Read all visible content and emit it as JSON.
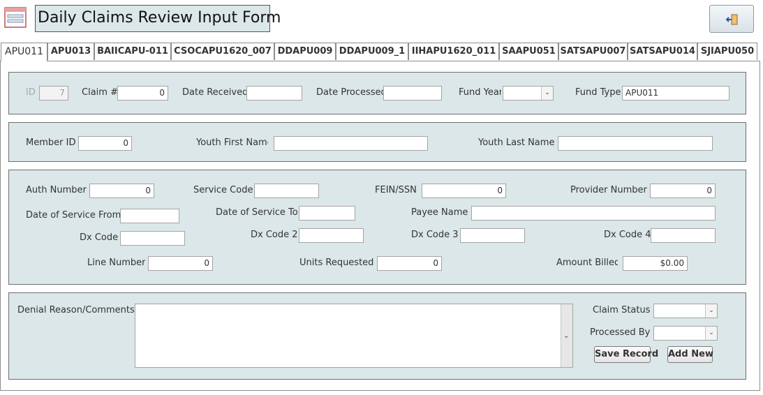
{
  "header": {
    "title": "Daily Claims Review Input Form",
    "form_icon": "form-icon",
    "exit_icon": "exit-door-icon"
  },
  "tabs": [
    "APU011",
    "APU013",
    "BAIICAPU-011",
    "CSOCAPU1620_007",
    "DDAPU009",
    "DDAPU009_1",
    "IIHAPU1620_011",
    "SAAPU051",
    "SATSAPU007",
    "SATSAPU014",
    "SJIAPU050"
  ],
  "active_tab": "APU011",
  "section1": {
    "id_label": "ID",
    "id_value": "7",
    "claim_label": "Claim #",
    "claim_value": "0",
    "date_received_label": "Date Received",
    "date_received_value": "",
    "date_processed_label": "Date Processed",
    "date_processed_value": "",
    "fund_year_label": "Fund Year",
    "fund_year_value": "",
    "fund_type_label": "Fund Type",
    "fund_type_value": "APU011"
  },
  "section2": {
    "member_id_label": "Member ID",
    "member_id_value": "0",
    "youth_first_label": "Youth First Name",
    "youth_first_value": "",
    "youth_last_label": "Youth Last Name",
    "youth_last_value": ""
  },
  "section3": {
    "auth_number_label": "Auth Number",
    "auth_number_value": "0",
    "service_code_label": "Service Code",
    "service_code_value": "",
    "fein_label": "FEIN/SSN",
    "fein_value": "0",
    "provider_number_label": "Provider Number",
    "provider_number_value": "0",
    "dos_from_label": "Date of Service From",
    "dos_from_value": "",
    "dos_to_label": "Date of Service To",
    "dos_to_value": "",
    "payee_label": "Payee Name",
    "payee_value": "",
    "dx_code_label": "Dx Code",
    "dx_code_value": "",
    "dx_code2_label": "Dx Code 2",
    "dx_code2_value": "",
    "dx_code3_label": "Dx Code 3",
    "dx_code3_value": "",
    "dx_code4_label": "Dx Code 4",
    "dx_code4_value": "",
    "line_number_label": "Line Number",
    "line_number_value": "0",
    "units_label": "Units Requested",
    "units_value": "0",
    "amount_label": "Amount Billed",
    "amount_value": "$0.00"
  },
  "section4": {
    "denial_label": "Denial Reason/Comments",
    "denial_value": "",
    "claim_status_label": "Claim Status",
    "claim_status_value": "",
    "processed_by_label": "Processed By",
    "processed_by_value": "",
    "save_label": "Save Record",
    "add_new_label": "Add New"
  }
}
